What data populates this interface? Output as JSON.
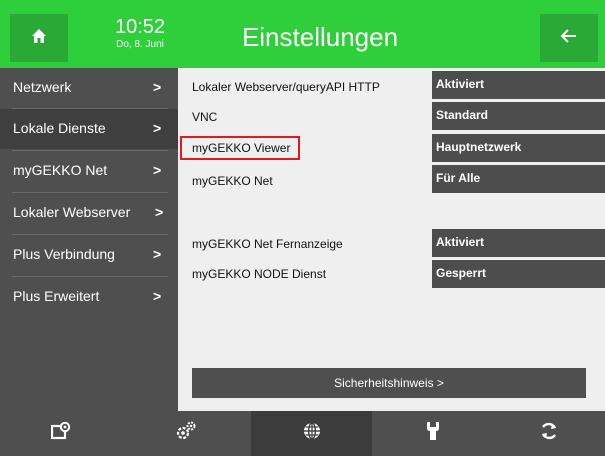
{
  "header": {
    "time": "10:52",
    "date": "Do, 8. Juni",
    "title": "Einstellungen",
    "home_icon": "home-icon",
    "back_icon": "arrow-left-icon"
  },
  "sidebar": {
    "items": [
      {
        "label": "Netzwerk",
        "chevron": ">",
        "active": false
      },
      {
        "label": "Lokale Dienste",
        "chevron": ">",
        "active": true
      },
      {
        "label": "myGEKKO Net",
        "chevron": ">",
        "active": false
      },
      {
        "label": "Lokaler Webserver",
        "chevron": ">",
        "active": false
      },
      {
        "label": "Plus Verbindung",
        "chevron": ">",
        "active": false
      },
      {
        "label": "Plus Erweitert",
        "chevron": ">",
        "active": false
      }
    ]
  },
  "settings": {
    "rows": [
      {
        "label": "Lokaler Webserver/queryAPI HTTP",
        "value": "Aktiviert"
      },
      {
        "label": "VNC",
        "value": "Standard"
      },
      {
        "label": "myGEKKO Viewer",
        "value": "Hauptnetzwerk",
        "highlighted": true
      },
      {
        "label": "myGEKKO Net",
        "value": "Für Alle"
      },
      {
        "label": "myGEKKO Net Fernanzeige",
        "value": "Aktiviert"
      },
      {
        "label": "myGEKKO NODE Dienst",
        "value": "Gesperrt"
      }
    ],
    "security_button": "Sicherheitshinweis >"
  },
  "bottom_nav": {
    "items": [
      {
        "icon": "devices-settings-icon"
      },
      {
        "icon": "gears-icon"
      },
      {
        "icon": "globe-icon",
        "active": true
      },
      {
        "icon": "wrench-icon"
      },
      {
        "icon": "refresh-icon"
      }
    ]
  },
  "colors": {
    "header_green": "#2fcf3b",
    "header_button_green": "#2aa937",
    "sidebar_gray": "#4f4f4f",
    "highlight_red": "#e11b1b"
  }
}
